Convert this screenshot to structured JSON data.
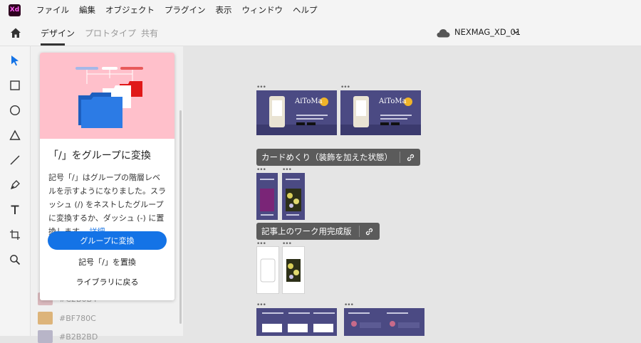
{
  "app": {
    "logo_text": "Xd"
  },
  "menu": [
    "ファイル",
    "編集",
    "オブジェクト",
    "プラグイン",
    "表示",
    "ウィンドウ",
    "ヘルプ"
  ],
  "tabs": [
    {
      "label": "デザイン",
      "active": true
    },
    {
      "label": "プロトタイプ",
      "active": false
    },
    {
      "label": "共有",
      "active": false
    }
  ],
  "document": {
    "name": "NEXMAG_XD_01"
  },
  "tools": [
    "select-tool",
    "rectangle-tool",
    "ellipse-tool",
    "polygon-tool",
    "line-tool",
    "pen-tool",
    "text-tool",
    "artboard-tool",
    "zoom-tool"
  ],
  "popup": {
    "title": "「/」をグループに変換",
    "body": "記号「/」はグループの階層レベルを示すようになりました。スラッシュ (/) をネストしたグループに変換するか、ダッシュ (-) に置換します。",
    "details_link": "詳細",
    "primary_button": "グループに変換",
    "replace_button": "記号「/」を置換",
    "back_button": "ライブラリに戻る"
  },
  "swatches": [
    {
      "color": "#D9B8BC",
      "label": "#C2B0B4"
    },
    {
      "color": "#DDB47A",
      "label": "#BF780C"
    },
    {
      "color": "#B8B5C8",
      "label": "#B2B2BD"
    }
  ],
  "canvas": {
    "artboard_thumb_text": "AiToMa",
    "groups": [
      {
        "label": "カードめくり（装飾を加えた状態）"
      },
      {
        "label": "記事上のワーク用完成版"
      }
    ]
  },
  "colors": {
    "accent": "#1473e6",
    "artboard": "#4b4a83",
    "hero": "#ffc0cb"
  }
}
